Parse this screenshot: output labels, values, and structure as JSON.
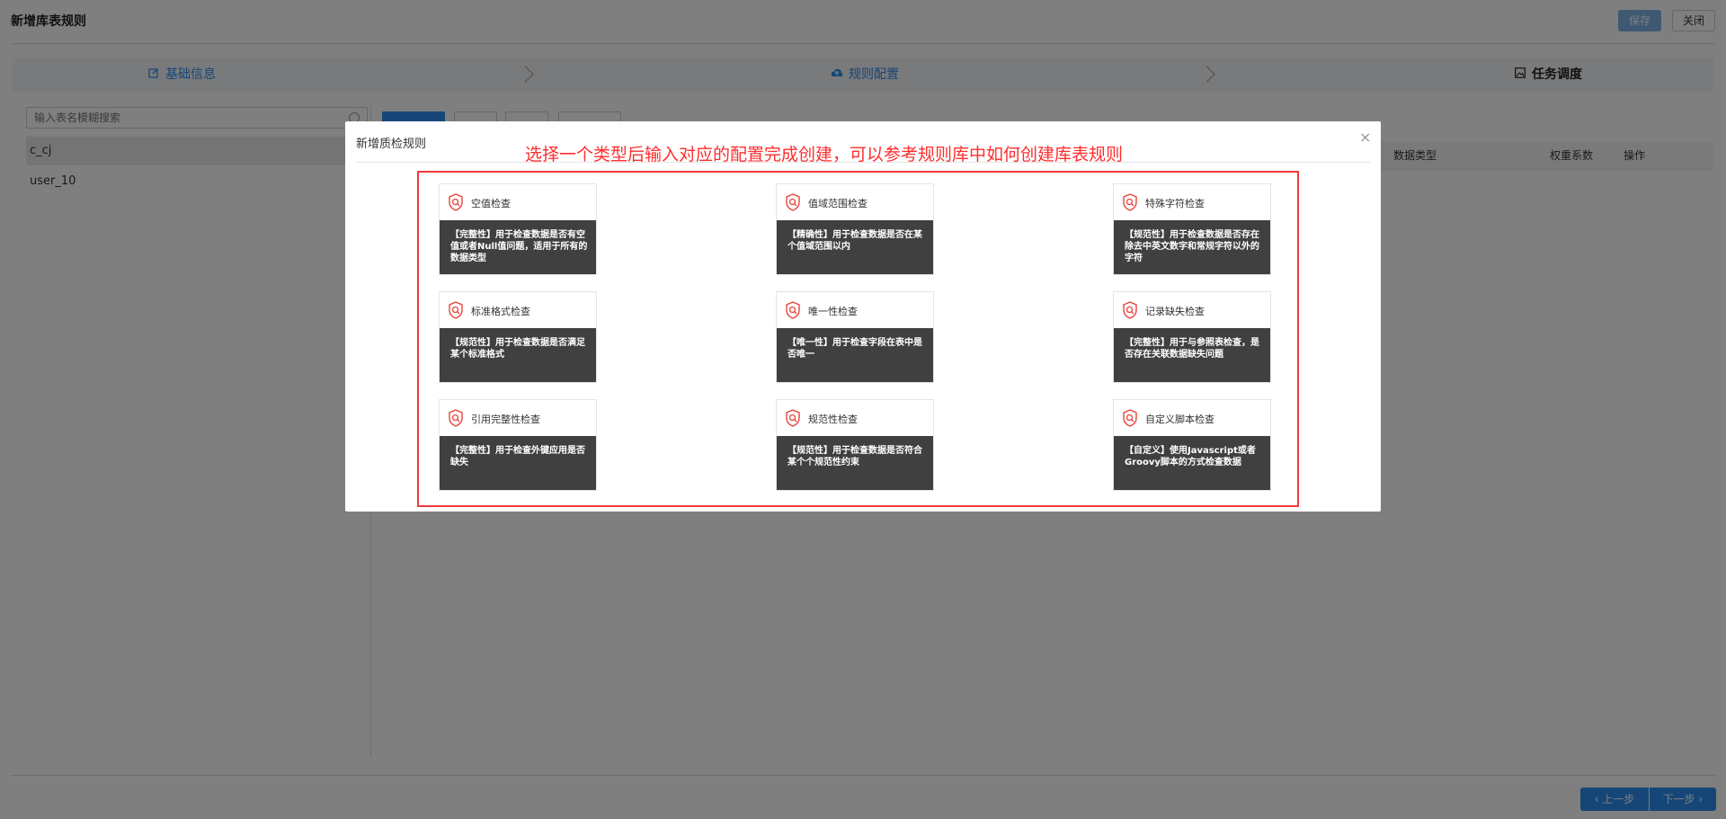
{
  "page": {
    "title": "新增库表规则",
    "save_label": "保存",
    "close_label": "关闭"
  },
  "steps": [
    {
      "label": "基础信息",
      "icon": "edit-icon"
    },
    {
      "label": "规则配置",
      "icon": "cloud-upload-icon"
    },
    {
      "label": "任务调度",
      "icon": "image-icon"
    }
  ],
  "sidebar": {
    "search_placeholder": "输入表名模糊搜索",
    "items": [
      {
        "label": "c_cj",
        "active": true
      },
      {
        "label": "user_10",
        "active": false
      }
    ]
  },
  "table": {
    "columns": [
      "数据类型",
      "权重系数",
      "操作"
    ]
  },
  "footer": {
    "prev_label": "上一步",
    "next_label": "下一步"
  },
  "modal": {
    "title": "新增质检规则",
    "annotation": "选择一个类型后输入对应的配置完成创建，可以参考规则库中如何创建库表规则",
    "cards": [
      {
        "title": "空值检查",
        "desc": "【完整性】用于检查数据是否有空值或者Null值问题，适用于所有的数据类型"
      },
      {
        "title": "值域范围检查",
        "desc": "【精确性】用于检查数据是否在某个值域范围以内"
      },
      {
        "title": "特殊字符检查",
        "desc": "【规范性】用于检查数据是否存在除去中英文数字和常规字符以外的字符"
      },
      {
        "title": "标准格式检查",
        "desc": "【规范性】用于检查数据是否满足某个标准格式"
      },
      {
        "title": "唯一性检查",
        "desc": "【唯一性】用于检查字段在表中是否唯一"
      },
      {
        "title": "记录缺失检查",
        "desc": "【完整性】用于与参照表检查，是否存在关联数据缺失问题"
      },
      {
        "title": "引用完整性检查",
        "desc": "【完整性】用于检查外键应用是否缺失"
      },
      {
        "title": "规范性检查",
        "desc": "【规范性】用于检查数据是否符合某个个规范性约束"
      },
      {
        "title": "自定义脚本检查",
        "desc": "【自定义】使用Javascript或者Groovy脚本的方式检查数据"
      }
    ]
  },
  "colors": {
    "accent": "#2d8cf0",
    "annotation": "#ff2d2d",
    "card_body": "#404040",
    "icon": "#e8453c"
  }
}
